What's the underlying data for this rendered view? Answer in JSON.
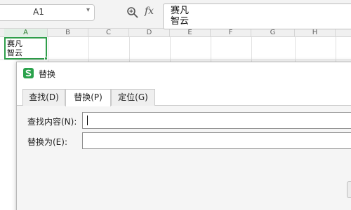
{
  "formula_bar": {
    "name_box_value": "A1",
    "formula_line1": "赛凡",
    "formula_line2": "智云",
    "icons": [
      "zoom-icon",
      "fx-icon",
      "chevron-down-icon"
    ]
  },
  "sheet": {
    "columns": [
      "A",
      "B",
      "C",
      "D",
      "E",
      "F",
      "G",
      "H"
    ],
    "active_column": "A",
    "cell_a1_line1": "赛凡",
    "cell_a1_line2": "智云",
    "selection_color": "#2e9e4a"
  },
  "dialog": {
    "title": "替换",
    "tabs": [
      "查找(D)",
      "替换(P)",
      "定位(G)"
    ],
    "active_tab": "替换(P)",
    "find_label": "查找内容(N):",
    "find_value": "",
    "replace_label": "替换为(E):",
    "replace_value": "",
    "app_icon": "wps-s-icon",
    "accent": "#2ba24c"
  }
}
